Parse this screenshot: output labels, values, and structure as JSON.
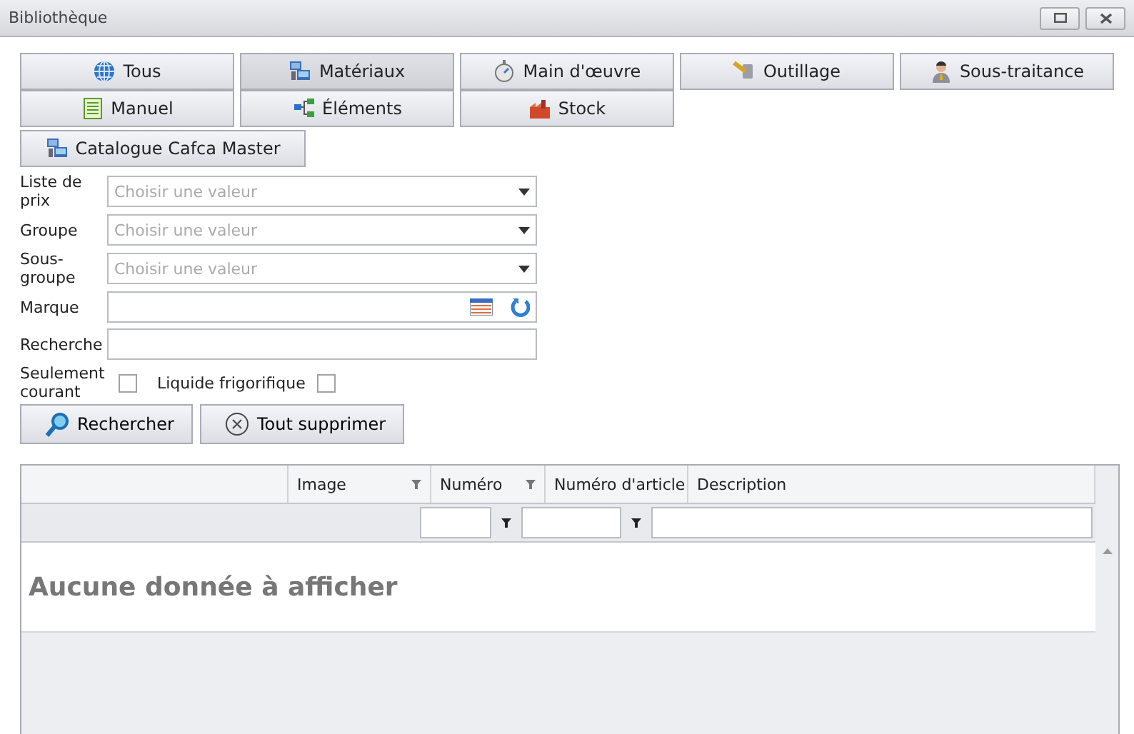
{
  "window": {
    "title": "Bibliothèque"
  },
  "categories": [
    {
      "label": "Tous",
      "selected": false
    },
    {
      "label": "Matériaux",
      "selected": true
    },
    {
      "label": "Main d'œuvre",
      "selected": false
    },
    {
      "label": "Outillage",
      "selected": false
    },
    {
      "label": "Sous-traitance",
      "selected": false
    },
    {
      "label": "Manuel",
      "selected": false
    },
    {
      "label": "Éléments",
      "selected": false
    },
    {
      "label": "Stock",
      "selected": false
    },
    {
      "label": "Catalogue Cafca Master",
      "selected": false
    }
  ],
  "filters": [
    {
      "label": "Liste de prix",
      "kind": "dropdown",
      "placeholder": "Choisir une valeur"
    },
    {
      "label": "Groupe",
      "kind": "dropdown",
      "placeholder": "Choisir une valeur"
    },
    {
      "label": "Sous-groupe",
      "kind": "dropdown",
      "placeholder": "Choisir une valeur"
    },
    {
      "label": "Marque",
      "kind": "picker"
    },
    {
      "label": "Recherche",
      "kind": "text"
    }
  ],
  "checkboxes": [
    {
      "label": "Seulement courant",
      "checked": false
    },
    {
      "label": "Liquide frigorifique",
      "checked": false
    }
  ],
  "actions": [
    {
      "label": "Rechercher"
    },
    {
      "label": "Tout supprimer"
    }
  ],
  "table": {
    "columns": [
      {
        "label": "Image"
      },
      {
        "label": "Numéro"
      },
      {
        "label": "Numéro d'article"
      },
      {
        "label": "Description"
      }
    ],
    "empty_message": "Aucune donnée à afficher"
  }
}
